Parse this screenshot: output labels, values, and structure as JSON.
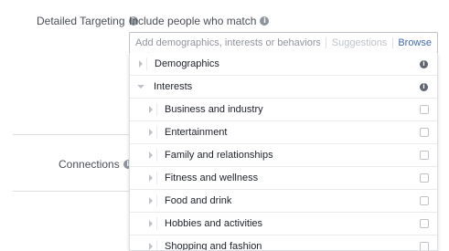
{
  "targeting": {
    "label": "Detailed Targeting",
    "include_label": "Include people who match",
    "search": {
      "placeholder": "Add demographics, interests or behaviors",
      "value": ""
    },
    "suggestions_label": "Suggestions",
    "browse_label": "Browse"
  },
  "connections": {
    "label": "Connections"
  },
  "categories": [
    {
      "label": "Demographics",
      "expanded": false
    },
    {
      "label": "Interests",
      "expanded": true
    }
  ],
  "interests": [
    {
      "label": "Business and industry",
      "checked": false
    },
    {
      "label": "Entertainment",
      "checked": false
    },
    {
      "label": "Family and relationships",
      "checked": false
    },
    {
      "label": "Fitness and wellness",
      "checked": false
    },
    {
      "label": "Food and drink",
      "checked": false
    },
    {
      "label": "Hobbies and activities",
      "checked": false
    },
    {
      "label": "Shopping and fashion",
      "checked": false
    }
  ],
  "icons": {
    "info": "info-icon",
    "expand": "chevron-right-icon",
    "collapse": "chevron-down-icon",
    "checkbox": "checkbox-icon"
  },
  "colors": {
    "accent": "#4267b2",
    "muted": "#bec3c9",
    "label": "#4b4f56",
    "border": "#dddfe2"
  }
}
